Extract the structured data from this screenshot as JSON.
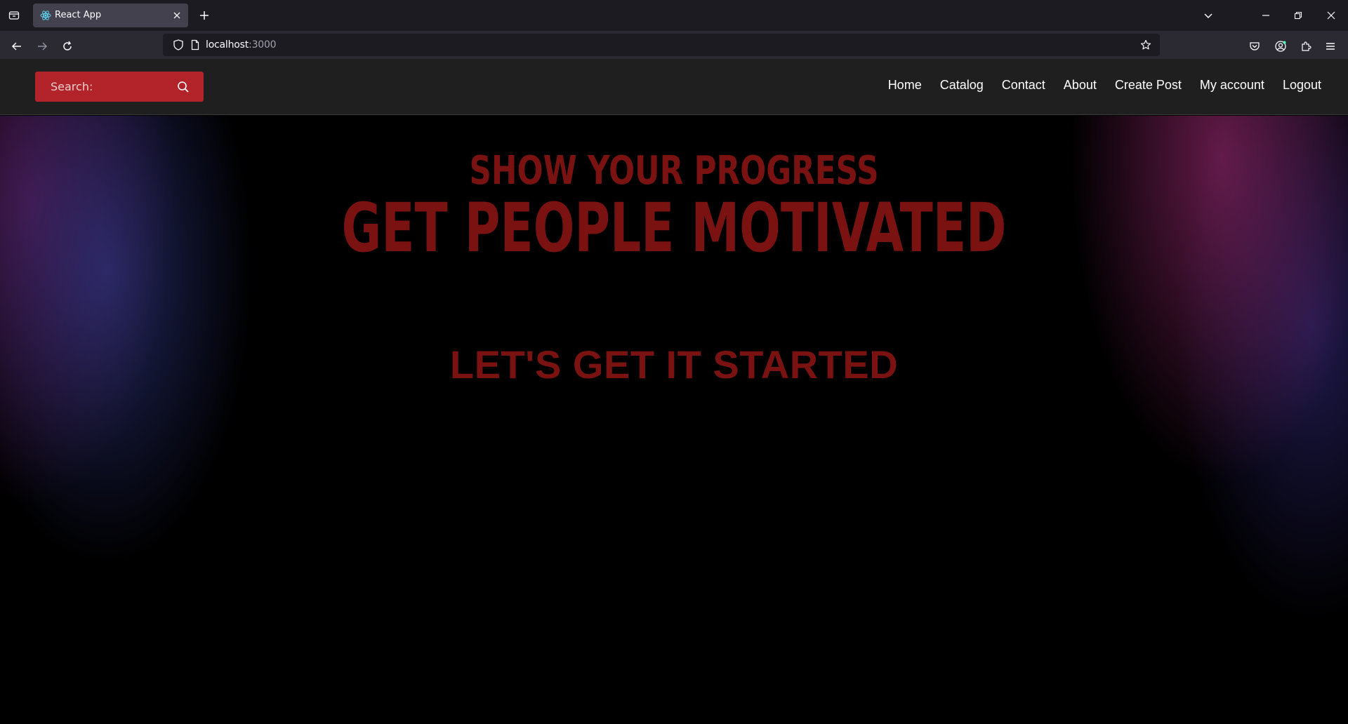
{
  "browser": {
    "tab_title": "React App",
    "url_host": "localhost",
    "url_port": ":3000"
  },
  "header": {
    "search_placeholder": "Search:",
    "nav": [
      "Home",
      "Catalog",
      "Contact",
      "About",
      "Create Post",
      "My account",
      "Logout"
    ]
  },
  "hero": {
    "subtitle": "SHOW YOUR PROGRESS",
    "title": "GET PEOPLE MOTIVATED",
    "cta": "LET'S GET IT STARTED"
  },
  "colors": {
    "accent": "#b3232a",
    "hero_text": "#7a1212",
    "header_bg": "#1f1f1f"
  }
}
